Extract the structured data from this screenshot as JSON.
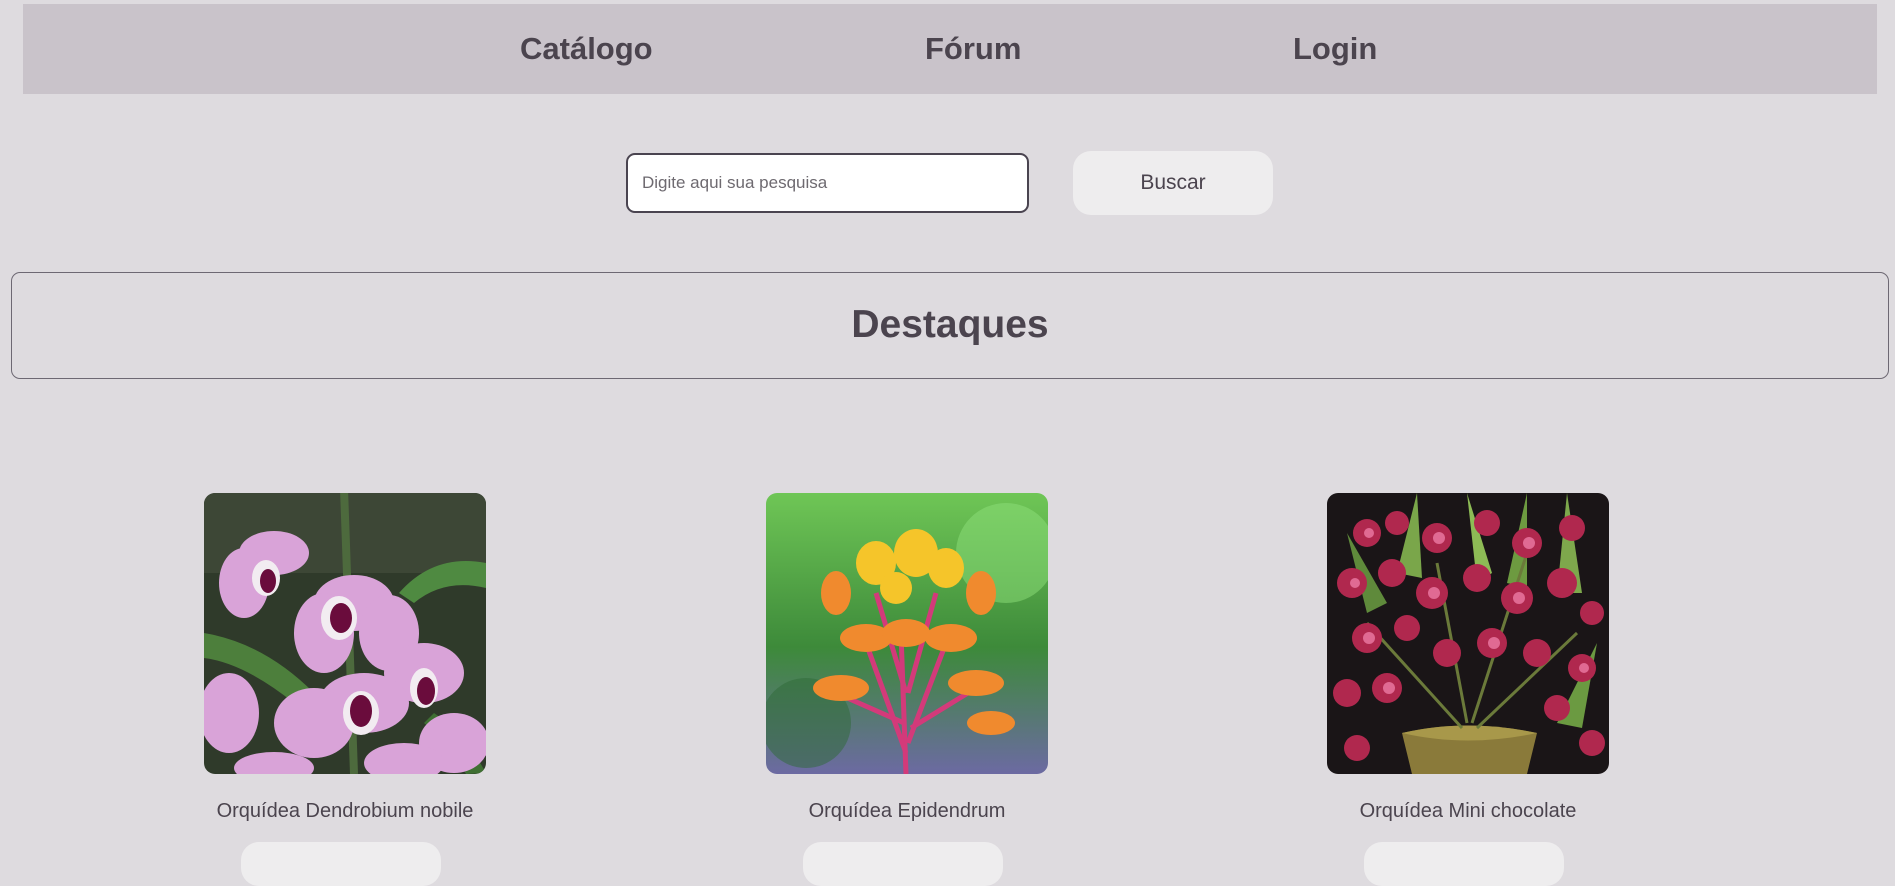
{
  "nav": {
    "links": [
      {
        "label": "Catálogo"
      },
      {
        "label": "Fórum"
      },
      {
        "label": "Login"
      }
    ]
  },
  "search": {
    "placeholder": "Digite aqui sua pesquisa",
    "value": "",
    "button_label": "Buscar"
  },
  "highlights": {
    "title": "Destaques"
  },
  "products": [
    {
      "name": "Orquídea Dendrobium nobile",
      "image_icon": "orchid-dendrobium-photo"
    },
    {
      "name": "Orquídea Epidendrum",
      "image_icon": "orchid-epidendrum-photo"
    },
    {
      "name": "Orquídea Mini chocolate",
      "image_icon": "orchid-mini-chocolate-photo"
    }
  ],
  "colors": {
    "page_background": "#dedbdf",
    "nav_background": "#c9c3ca",
    "text": "#4b444e",
    "button_background": "#eeedee"
  }
}
